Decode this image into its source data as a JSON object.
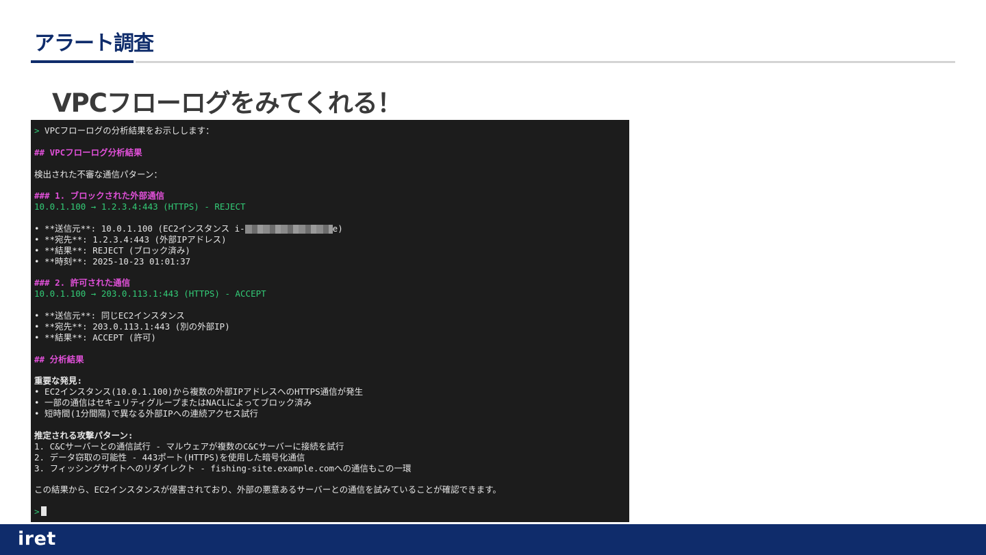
{
  "header": {
    "title": "アラート調査"
  },
  "subtitle": "VPCフローログをみてくれる！",
  "terminal": {
    "prompt": ">",
    "intro": " VPCフローログの分析結果をお示しします：",
    "h2_analysis": "## VPCフローログ分析結果",
    "detected": "検出された不審な通信パターン：",
    "h3_blocked": "### 1. ブロックされた外部通信",
    "flow_blocked": "10.0.1.100 → 1.2.3.4:443 (HTTPS) - REJECT",
    "b1_src_pre": "• **送信元**: 10.0.1.100 (EC2インスタンス i-",
    "b1_src_post": "e)",
    "b1_dst": "• **宛先**: 1.2.3.4:443 (外部IPアドレス)",
    "b1_result": "• **結果**: REJECT (ブロック済み)",
    "b1_time": "• **時刻**: 2025-10-23 01:01:37",
    "h3_allowed": "### 2. 許可された通信",
    "flow_allowed": "10.0.1.100 → 203.0.113.1:443 (HTTPS) - ACCEPT",
    "b2_src": "• **送信元**: 同じEC2インスタンス",
    "b2_dst": "• **宛先**: 203.0.113.1:443 (別の外部IP)",
    "b2_result": "• **結果**: ACCEPT (許可)",
    "h2_result": "## 分析結果",
    "findings_head": "重要な発見:",
    "finding1": "• EC2インスタンス(10.0.1.100)から複数の外部IPアドレスへのHTTPS通信が発生",
    "finding2": "• 一部の通信はセキュリティグループまたはNACLによってブロック済み",
    "finding3": "• 短時間(1分間隔)で異なる外部IPへの連続アクセス試行",
    "patterns_head": "推定される攻撃パターン:",
    "pattern1": "1. C&Cサーバーとの通信試行 - マルウェアが複数のC&Cサーバーに接続を試行",
    "pattern2": "2. データ窃取の可能性 - 443ポート(HTTPS)を使用した暗号化通信",
    "pattern3": "3. フィッシングサイトへのリダイレクト - fishing-site.example.comへの通信もこの一環",
    "conclusion": "この結果から、EC2インスタンスが侵害されており、外部の悪意あるサーバーとの通信を試みていることが確認できます。"
  },
  "footer": {
    "logo": "iret"
  },
  "colors": {
    "brand_navy": "#0f2c6b",
    "terminal_bg": "#1c1c1c",
    "terminal_green": "#33cc77",
    "terminal_pink": "#e050d8"
  }
}
